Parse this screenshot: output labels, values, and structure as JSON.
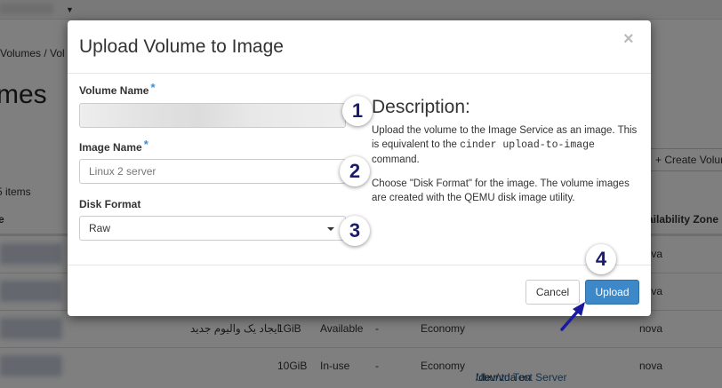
{
  "background": {
    "breadcrumb": "Volumes  /  Vol",
    "page_title": "mes",
    "items_count": "5 items",
    "create_button": "Create Volum",
    "table_headers": [
      "e",
      "ailability Zone"
    ],
    "rows": [
      {
        "availability_zone": "nova"
      },
      {
        "availability_zone": "nova"
      },
      {
        "name": "ایجاد یک والیوم جدید",
        "size": "1GiB",
        "status": "Available",
        "dash": "-",
        "type": "Economy",
        "availability_zone": "nova"
      },
      {
        "size": "10GiB",
        "status": "In-use",
        "dash": "-",
        "type": "Economy",
        "attached_prefix": "/dev/vda on",
        "attached_server": "Ubuntu Test Server",
        "availability_zone": "nova"
      }
    ]
  },
  "modal": {
    "title": "Upload Volume to Image",
    "close_glyph": "×",
    "volume_name_label": "Volume Name",
    "required_mark": "*",
    "volume_name_value": "",
    "image_name_label": "Image Name",
    "image_name_placeholder": "Linux 2 server",
    "disk_format_label": "Disk Format",
    "disk_format_value": "Raw",
    "description_heading": "Description:",
    "description_p1_a": "Upload the volume to the Image Service as an image. This is equivalent to the ",
    "description_p1_code": "cinder upload-to-image",
    "description_p1_b": " command.",
    "description_p2": "Choose \"Disk Format\" for the image. The volume images are created with the QEMU disk image utility.",
    "cancel_label": "Cancel",
    "upload_label": "Upload"
  },
  "annotations": {
    "markers": [
      "1",
      "2",
      "3",
      "4"
    ],
    "arrow_color": "#1a1aa0"
  }
}
